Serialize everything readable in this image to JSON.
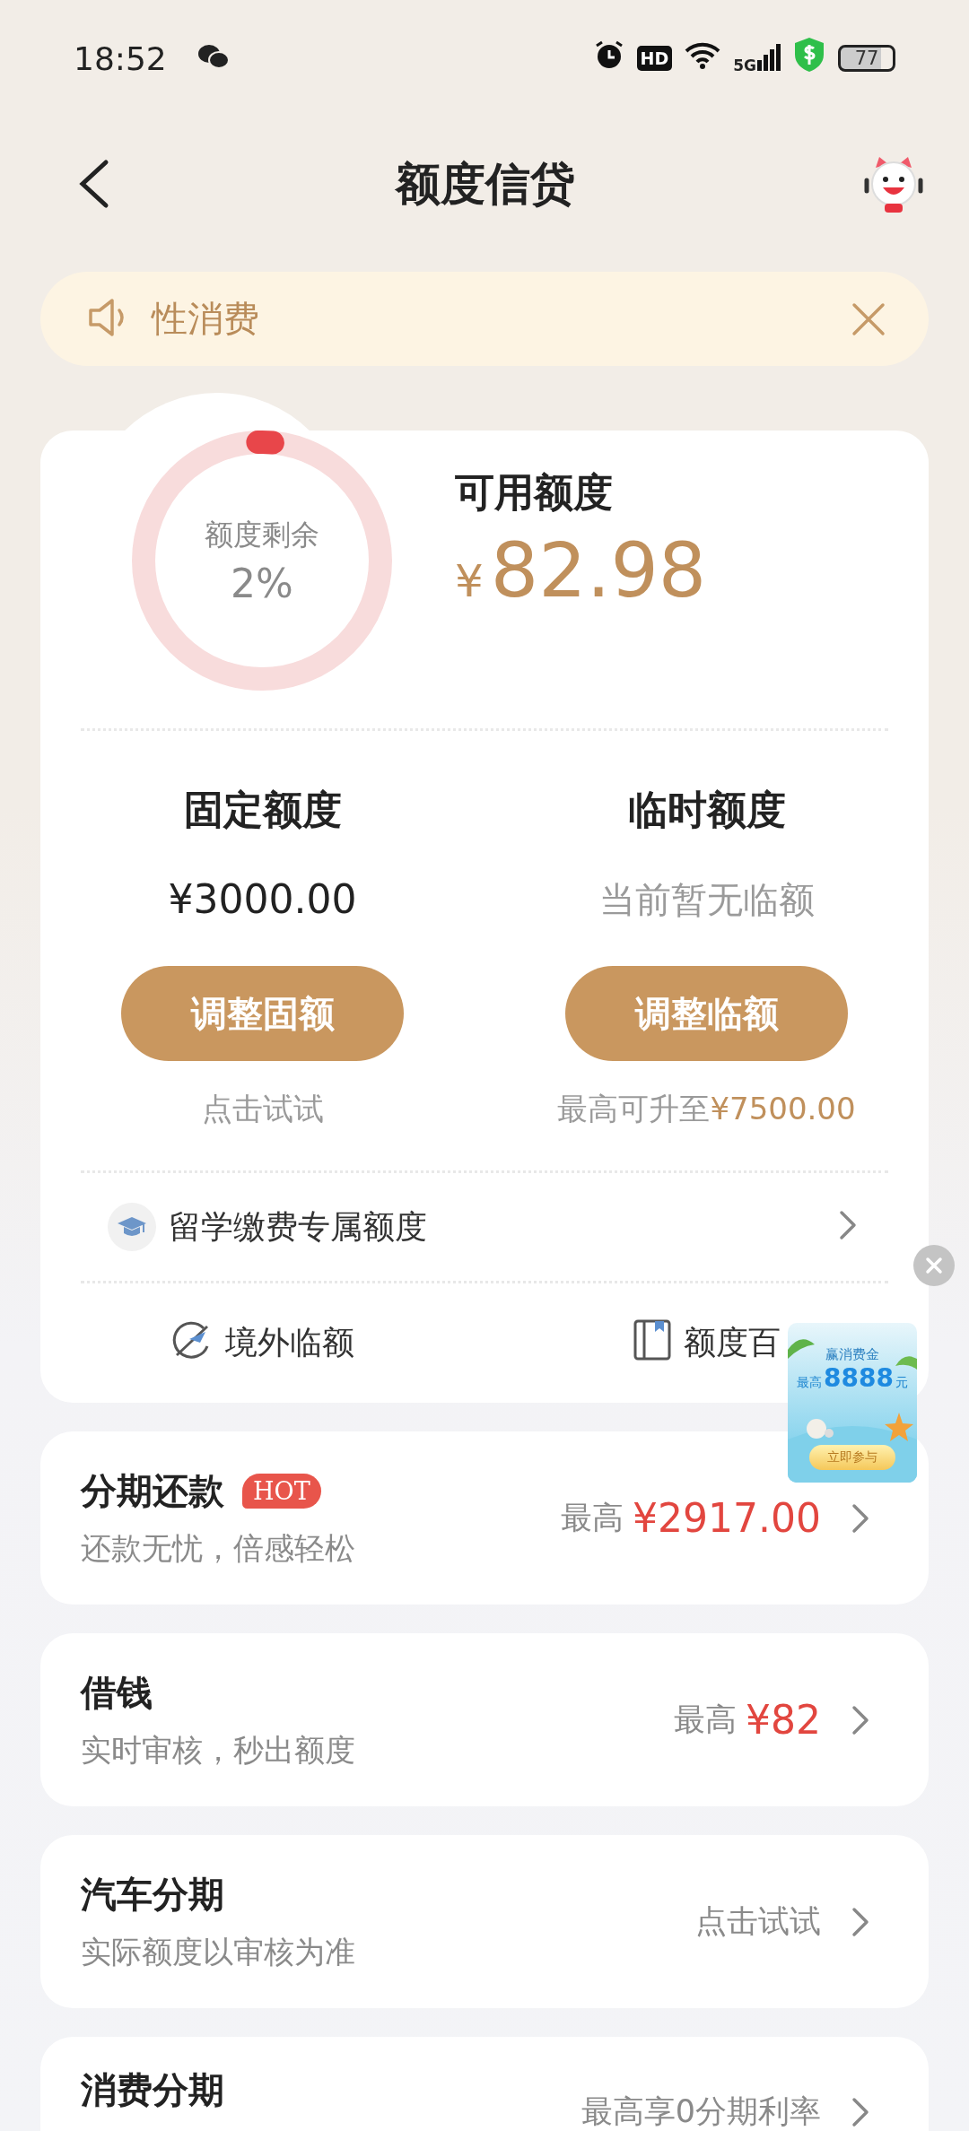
{
  "status_bar": {
    "time": "18:52",
    "hd": "HD",
    "network": "5G",
    "battery": "77"
  },
  "header": {
    "title": "额度信贷"
  },
  "notice": {
    "text": "性消费"
  },
  "quota": {
    "ring": {
      "label": "额度剩余",
      "percent": "2%"
    },
    "available_label": "可用额度",
    "currency": "¥",
    "available_amount": "82.98",
    "columns": [
      {
        "title": "固定额度",
        "value": "¥3000.00",
        "button": "调整固额",
        "hint": "点击试试"
      },
      {
        "title": "临时额度",
        "value": "当前暂无临额",
        "button": "调整临额",
        "hint": "最高可升至",
        "hint_amount": "¥7500.00"
      }
    ],
    "special_row": "留学缴费专属额度",
    "links": [
      {
        "kind": "plane",
        "label": "境外临额"
      },
      {
        "kind": "book",
        "label": "额度百"
      }
    ]
  },
  "float_ad": {
    "title": "赢消费金",
    "prefix": "最高",
    "amount": "8888",
    "unit": "元",
    "button": "立即参与"
  },
  "products": [
    {
      "title": "分期还款",
      "badge": "HOT",
      "subtitle": "还款无忧，倍感轻松",
      "kind": "amount",
      "prefix": "最高",
      "amount": "¥2917.00"
    },
    {
      "title": "借钱",
      "subtitle": "实时审核，秒出额度",
      "kind": "amount",
      "prefix": "最高",
      "amount": "¥82"
    },
    {
      "title": "汽车分期",
      "subtitle": "实际额度以审核为准",
      "kind": "note",
      "note": "点击试试"
    },
    {
      "title": "消费分期",
      "kind": "note",
      "note": "最高享0分期利率"
    }
  ]
}
